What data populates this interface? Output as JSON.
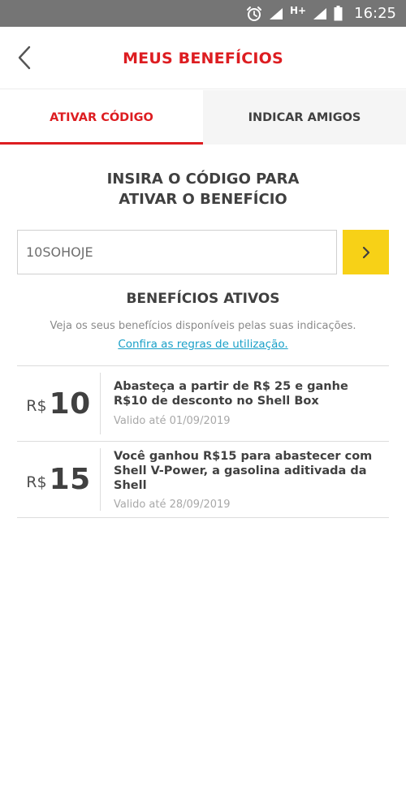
{
  "status_bar": {
    "network": "H+",
    "time": "16:25",
    "icons": [
      "alarm-icon",
      "signal-icon",
      "signal-icon",
      "battery-icon"
    ]
  },
  "header": {
    "title": "MEUS BENEFÍCIOS",
    "back_icon": "chevron-left-icon"
  },
  "tabs": [
    {
      "label": "ATIVAR CÓDIGO",
      "active": true
    },
    {
      "label": "INDICAR AMIGOS",
      "active": false
    }
  ],
  "code_section": {
    "heading_line1": "INSIRA O CÓDIGO PARA",
    "heading_line2": "ATIVAR O BENEFÍCIO",
    "input_value": "10SOHOJE",
    "submit_icon": "chevron-right-icon"
  },
  "benefits": {
    "title": "BENEFÍCIOS ATIVOS",
    "description": "Veja os seus benefícios disponíveis pelas suas indicações.",
    "rules_link": "Confira as regras de utilização.",
    "items": [
      {
        "currency": "R$",
        "amount": "10",
        "text": "Abasteça a partir de R$ 25 e ganhe R$10 de desconto no Shell Box",
        "validity": "Valido até 01/09/2019"
      },
      {
        "currency": "R$",
        "amount": "15",
        "text": "Você ganhou R$15 para abastecer com Shell V-Power, a gasolina aditivada da Shell",
        "validity": "Valido até 28/09/2019"
      }
    ]
  },
  "colors": {
    "brand_red": "#dd1d21",
    "brand_yellow": "#f7d117",
    "link_blue": "#1aa0c8",
    "status_bar": "#757575"
  }
}
